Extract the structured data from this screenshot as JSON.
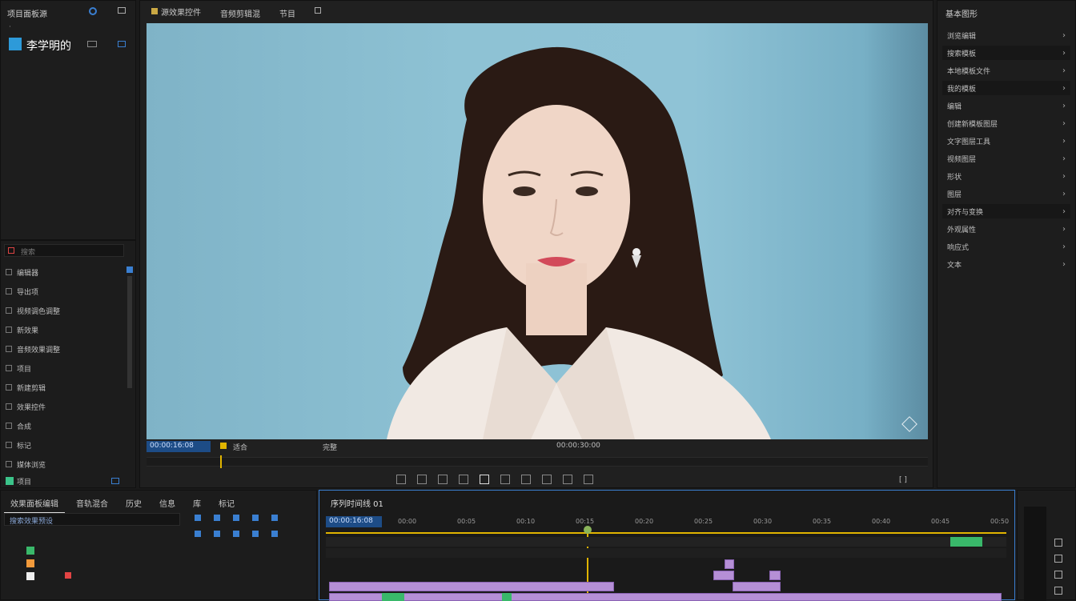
{
  "left_panel": {
    "title": "项目面板源",
    "project_name": "李学明的",
    "search_placeholder": "搜索",
    "items": [
      {
        "label": "编辑器"
      },
      {
        "label": "导出项"
      },
      {
        "label": "视频调色调整"
      },
      {
        "label": "新效果"
      },
      {
        "label": "音频效果调整"
      },
      {
        "label": "项目"
      },
      {
        "label": "新建剪辑"
      },
      {
        "label": "效果控件"
      },
      {
        "label": "合成"
      },
      {
        "label": "标记"
      },
      {
        "label": "媒体浏览"
      }
    ],
    "footer_label": "项目"
  },
  "viewer": {
    "tabs": [
      {
        "label": "源效果控件"
      },
      {
        "label": "音频剪辑混"
      },
      {
        "label": "节目"
      }
    ],
    "timecode": "00:00:16:08",
    "fit_label": "适合",
    "quality_label": "完整",
    "duration": "00:00:30:00",
    "footer_right": "[ ]"
  },
  "right_panel": {
    "title": "基本图形",
    "items": [
      {
        "label": "浏览编辑"
      },
      {
        "label": "搜索模板"
      },
      {
        "label": "本地模板文件"
      },
      {
        "label": "我的模板"
      },
      {
        "label": "编辑"
      },
      {
        "label": "创建新模板图层"
      },
      {
        "label": "文字图层工具"
      },
      {
        "label": "视频图层"
      },
      {
        "label": "形状"
      },
      {
        "label": "图层"
      },
      {
        "label": "对齐与变换"
      },
      {
        "label": "外观属性"
      },
      {
        "label": "响应式"
      },
      {
        "label": "文本"
      }
    ]
  },
  "bottom_left": {
    "tabs": [
      {
        "label": "效果面板编辑"
      },
      {
        "label": "音轨混合"
      },
      {
        "label": "历史"
      },
      {
        "label": "信息"
      },
      {
        "label": "库"
      },
      {
        "label": "标记"
      }
    ],
    "search_label": "搜索效果预设"
  },
  "timeline": {
    "sequence_name": "序列时间线 01",
    "timecode": "00:00:16:08",
    "ruler_labels": [
      "00:00",
      "00:05",
      "00:10",
      "00:15",
      "00:20",
      "00:25",
      "00:30",
      "00:35",
      "00:40",
      "00:45",
      "00:50"
    ]
  },
  "colors": {
    "accent_blue": "#3a7fd1",
    "scrub_yellow": "#e1b400",
    "clip_purple": "#b58fd6",
    "clip_green": "#39b86a"
  }
}
